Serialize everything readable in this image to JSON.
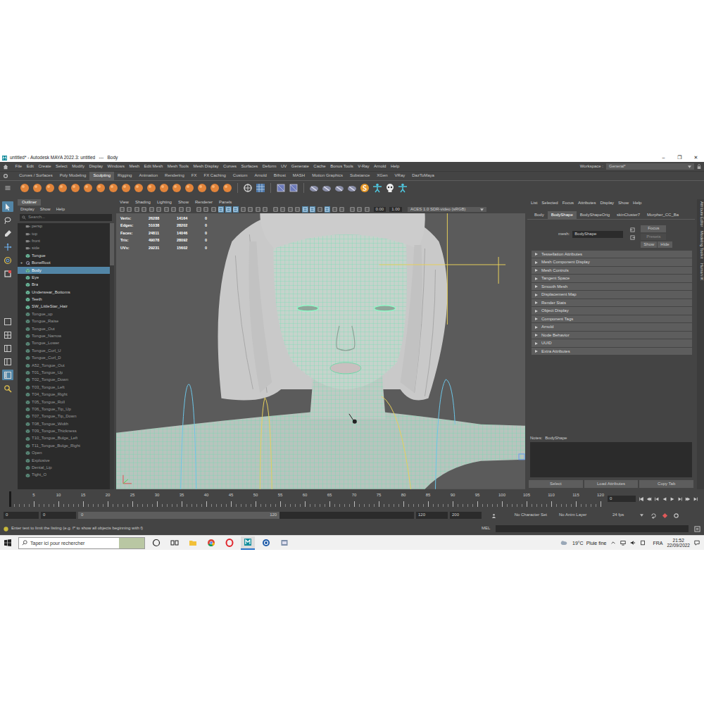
{
  "window": {
    "title": "untitled* - Autodesk MAYA 2022.3: untitled   ---   Body",
    "controls": [
      "–",
      "❐",
      "✕"
    ]
  },
  "menu": [
    "File",
    "Edit",
    "Create",
    "Select",
    "Modify",
    "Display",
    "Windows",
    "Mesh",
    "Edit Mesh",
    "Mesh Tools",
    "Mesh Display",
    "Curves",
    "Surfaces",
    "Deform",
    "UV",
    "Generate",
    "Cache",
    "Bonus Tools",
    "V-Ray",
    "Arnold",
    "Help"
  ],
  "workspace": {
    "label": "Workspace :",
    "value": "General*"
  },
  "shelf_tabs": [
    {
      "label": "Curves / Surfaces",
      "selected": false
    },
    {
      "label": "Poly Modeling",
      "selected": false
    },
    {
      "label": "Sculpting",
      "selected": true
    },
    {
      "label": "Rigging",
      "selected": false
    },
    {
      "label": "Animation",
      "selected": false
    },
    {
      "label": "Rendering",
      "selected": false
    },
    {
      "label": "FX",
      "selected": false
    },
    {
      "label": "FX Caching",
      "selected": false
    },
    {
      "label": "Custom",
      "selected": false
    },
    {
      "label": "Arnold",
      "selected": false
    },
    {
      "label": "Bifrost",
      "selected": false
    },
    {
      "label": "MASH",
      "selected": false
    },
    {
      "label": "Motion Graphics",
      "selected": false
    },
    {
      "label": "Substance",
      "selected": false
    },
    {
      "label": "XGen",
      "selected": false
    },
    {
      "label": "VRay",
      "selected": false
    },
    {
      "label": "DazToMaya",
      "selected": false
    }
  ],
  "tools": [
    {
      "kind": "select",
      "selected": true
    },
    {
      "kind": "lasso",
      "selected": false
    },
    {
      "kind": "paint",
      "selected": false
    },
    {
      "kind": "move",
      "selected": false
    },
    {
      "kind": "rotate",
      "selected": false
    },
    {
      "kind": "scale",
      "selected": false
    },
    {
      "kind": "single-view",
      "selected": false
    },
    {
      "kind": "quad-view",
      "selected": false
    },
    {
      "kind": "split-view",
      "selected": false
    },
    {
      "kind": "split-view",
      "selected": false
    },
    {
      "kind": "outliner-view",
      "selected": true
    },
    {
      "kind": "search",
      "selected": false
    }
  ],
  "outliner": {
    "title": "Outliner",
    "menu": [
      "Display",
      "Show",
      "Help"
    ],
    "search": {
      "placeholder": "Search..."
    },
    "items": [
      {
        "label": "persp",
        "kind": "camera",
        "selected": false,
        "dimmed": true
      },
      {
        "label": "top",
        "kind": "camera",
        "selected": false,
        "dimmed": true
      },
      {
        "label": "front",
        "kind": "camera",
        "selected": false,
        "dimmed": true
      },
      {
        "label": "side",
        "kind": "camera",
        "selected": false,
        "dimmed": true
      },
      {
        "label": "Tongue",
        "kind": "mesh",
        "selected": false,
        "dimmed": false
      },
      {
        "label": "BoneRoot",
        "kind": "joint",
        "selected": false,
        "dimmed": false,
        "expander": "+"
      },
      {
        "label": "Body",
        "kind": "mesh",
        "selected": true,
        "dimmed": false
      },
      {
        "label": "Eye",
        "kind": "mesh",
        "selected": false,
        "dimmed": false
      },
      {
        "label": "Bra",
        "kind": "mesh",
        "selected": false,
        "dimmed": false
      },
      {
        "label": "Underwear_Bottoms",
        "kind": "mesh",
        "selected": false,
        "dimmed": false
      },
      {
        "label": "Teeth",
        "kind": "mesh",
        "selected": false,
        "dimmed": false
      },
      {
        "label": "SW_LittleStar_Hair",
        "kind": "mesh",
        "selected": false,
        "dimmed": false
      },
      {
        "label": "Tongue_up",
        "kind": "mesh",
        "selected": false,
        "dimmed": true
      },
      {
        "label": "Tongue_Raise",
        "kind": "mesh",
        "selected": false,
        "dimmed": true
      },
      {
        "label": "Tongue_Out",
        "kind": "mesh",
        "selected": false,
        "dimmed": true
      },
      {
        "label": "Tongue_Narrow",
        "kind": "mesh",
        "selected": false,
        "dimmed": true
      },
      {
        "label": "Tongue_Lower",
        "kind": "mesh",
        "selected": false,
        "dimmed": true
      },
      {
        "label": "Tongue_Curl_U",
        "kind": "mesh",
        "selected": false,
        "dimmed": true
      },
      {
        "label": "Tongue_Curl_D",
        "kind": "mesh",
        "selected": false,
        "dimmed": true
      },
      {
        "label": "A52_Tongue_Out",
        "kind": "mesh",
        "selected": false,
        "dimmed": true
      },
      {
        "label": "T01_Tongue_Up",
        "kind": "mesh",
        "selected": false,
        "dimmed": true
      },
      {
        "label": "T02_Tongue_Down",
        "kind": "mesh",
        "selected": false,
        "dimmed": true
      },
      {
        "label": "T03_Tongue_Left",
        "kind": "mesh",
        "selected": false,
        "dimmed": true
      },
      {
        "label": "T04_Tongue_Right",
        "kind": "mesh",
        "selected": false,
        "dimmed": true
      },
      {
        "label": "T05_Tongue_Roll",
        "kind": "mesh",
        "selected": false,
        "dimmed": true
      },
      {
        "label": "T06_Tongue_Tip_Up",
        "kind": "mesh",
        "selected": false,
        "dimmed": true
      },
      {
        "label": "T07_Tongue_Tip_Down",
        "kind": "mesh",
        "selected": false,
        "dimmed": true
      },
      {
        "label": "T08_Tongue_Width",
        "kind": "mesh",
        "selected": false,
        "dimmed": true
      },
      {
        "label": "T09_Tongue_Thickness",
        "kind": "mesh",
        "selected": false,
        "dimmed": true
      },
      {
        "label": "T10_Tongue_Bulge_Left",
        "kind": "mesh",
        "selected": false,
        "dimmed": true
      },
      {
        "label": "T11_Tongue_Bulge_Right",
        "kind": "mesh",
        "selected": false,
        "dimmed": true
      },
      {
        "label": "Open",
        "kind": "mesh",
        "selected": false,
        "dimmed": true
      },
      {
        "label": "Explosive",
        "kind": "mesh",
        "selected": false,
        "dimmed": true
      },
      {
        "label": "Dental_Lip",
        "kind": "mesh",
        "selected": false,
        "dimmed": true
      },
      {
        "label": "Tight_O",
        "kind": "mesh",
        "selected": false,
        "dimmed": true
      }
    ]
  },
  "viewport": {
    "menu": [
      "View",
      "Shading",
      "Lighting",
      "Show",
      "Renderer",
      "Panels"
    ],
    "toolbar": [
      {
        "on": false
      },
      {
        "on": false
      },
      {
        "on": false
      },
      {
        "on": false
      },
      {
        "on": false
      },
      {
        "on": false
      },
      {
        "on": false
      },
      {
        "on": false
      },
      {
        "on": false
      },
      {
        "on": false
      },
      {
        "on": false
      },
      {
        "on": false
      },
      {
        "on": false
      },
      {
        "on": true
      },
      {
        "on": true
      },
      {
        "on": true
      },
      {
        "on": false
      },
      {
        "on": false
      },
      {
        "on": false
      },
      {
        "on": false
      },
      {
        "on": false
      },
      {
        "on": false
      },
      {
        "on": false
      },
      {
        "on": false
      },
      {
        "on": true
      },
      {
        "on": true
      },
      {
        "on": false
      },
      {
        "on": true
      },
      {
        "on": false
      },
      {
        "on": false
      },
      {
        "on": false
      },
      {
        "on": false
      },
      {
        "on": false
      }
    ],
    "exposure": "0.00",
    "gamma": "1.00",
    "color_space": "ACES 1.0 SDR-video (sRGB)",
    "stats": [
      {
        "label": "Verts:",
        "values": [
          "26288",
          "14164",
          "0"
        ]
      },
      {
        "label": "Edges:",
        "values": [
          "51038",
          "28202",
          "0"
        ]
      },
      {
        "label": "Faces:",
        "values": [
          "24811",
          "14046",
          "0"
        ]
      },
      {
        "label": "Tris:",
        "values": [
          "49078",
          "28092",
          "0"
        ]
      },
      {
        "label": "UVs:",
        "values": [
          "29231",
          "15602",
          "0"
        ]
      }
    ]
  },
  "attribute_editor": {
    "menu": [
      "List",
      "Selected",
      "Focus",
      "Attributes",
      "Display",
      "Show",
      "Help"
    ],
    "tabs": [
      {
        "label": "Body",
        "selected": false
      },
      {
        "label": "BodyShape",
        "selected": true
      },
      {
        "label": "BodyShapeOrig",
        "selected": false
      },
      {
        "label": "skinCluster7",
        "selected": false
      },
      {
        "label": "Morpher_CC_Ba",
        "selected": false
      }
    ],
    "field": {
      "label": "mesh:",
      "value": "BodyShape"
    },
    "buttons": [
      "Focus",
      "Presets",
      "Show",
      "Hide"
    ],
    "sections": [
      "Tessellation Attributes",
      "Mesh Component Display",
      "Mesh Controls",
      "Tangent Space",
      "Smooth Mesh",
      "Displacement Map",
      "Render Stats",
      "Object Display",
      "Component Tags",
      "Arnold",
      "Node Behavior",
      "UUID",
      "Extra Attributes"
    ],
    "notes": {
      "label": "Notes:",
      "value": "BodyShape"
    },
    "footer_buttons": [
      "Select",
      "Load Attributes",
      "Copy Tab"
    ]
  },
  "side_tabs": [
    "Attribute Editor",
    "Modeling Toolkit",
    "Human IK"
  ],
  "timeline": {
    "ticks": [
      "5",
      "10",
      "15",
      "20",
      "25",
      "30",
      "35",
      "40",
      "45",
      "50",
      "55",
      "60",
      "65",
      "70",
      "75",
      "80",
      "85",
      "90",
      "95",
      "100",
      "105",
      "110",
      "115",
      "120"
    ],
    "current": "0"
  },
  "range": {
    "start": "0",
    "playback_start": "0",
    "handle_start": "0",
    "handle_end": "120",
    "playback_end": "120",
    "end": "200",
    "character_set": "No Character Set",
    "anim_layer": "No Anim Layer",
    "fps": "24 fps"
  },
  "command": {
    "help": "Enter text to limit the listing (e.g. f* to show all objects beginning with f)",
    "language": "MEL"
  },
  "taskbar": {
    "search": "Taper ici pour rechercher",
    "apps": [
      {
        "kind": "cortana",
        "selected": false
      },
      {
        "kind": "task-view",
        "selected": false
      },
      {
        "kind": "explorer",
        "selected": false
      },
      {
        "kind": "chrome",
        "selected": false
      },
      {
        "kind": "opera",
        "selected": false
      },
      {
        "kind": "maya",
        "selected": true
      },
      {
        "kind": "c-app",
        "selected": false
      },
      {
        "kind": "app",
        "selected": false
      }
    ],
    "temperature": "19°C",
    "weather": "Pluie fine",
    "language": "FRA",
    "time": "21:52",
    "date": "22/09/2022"
  }
}
